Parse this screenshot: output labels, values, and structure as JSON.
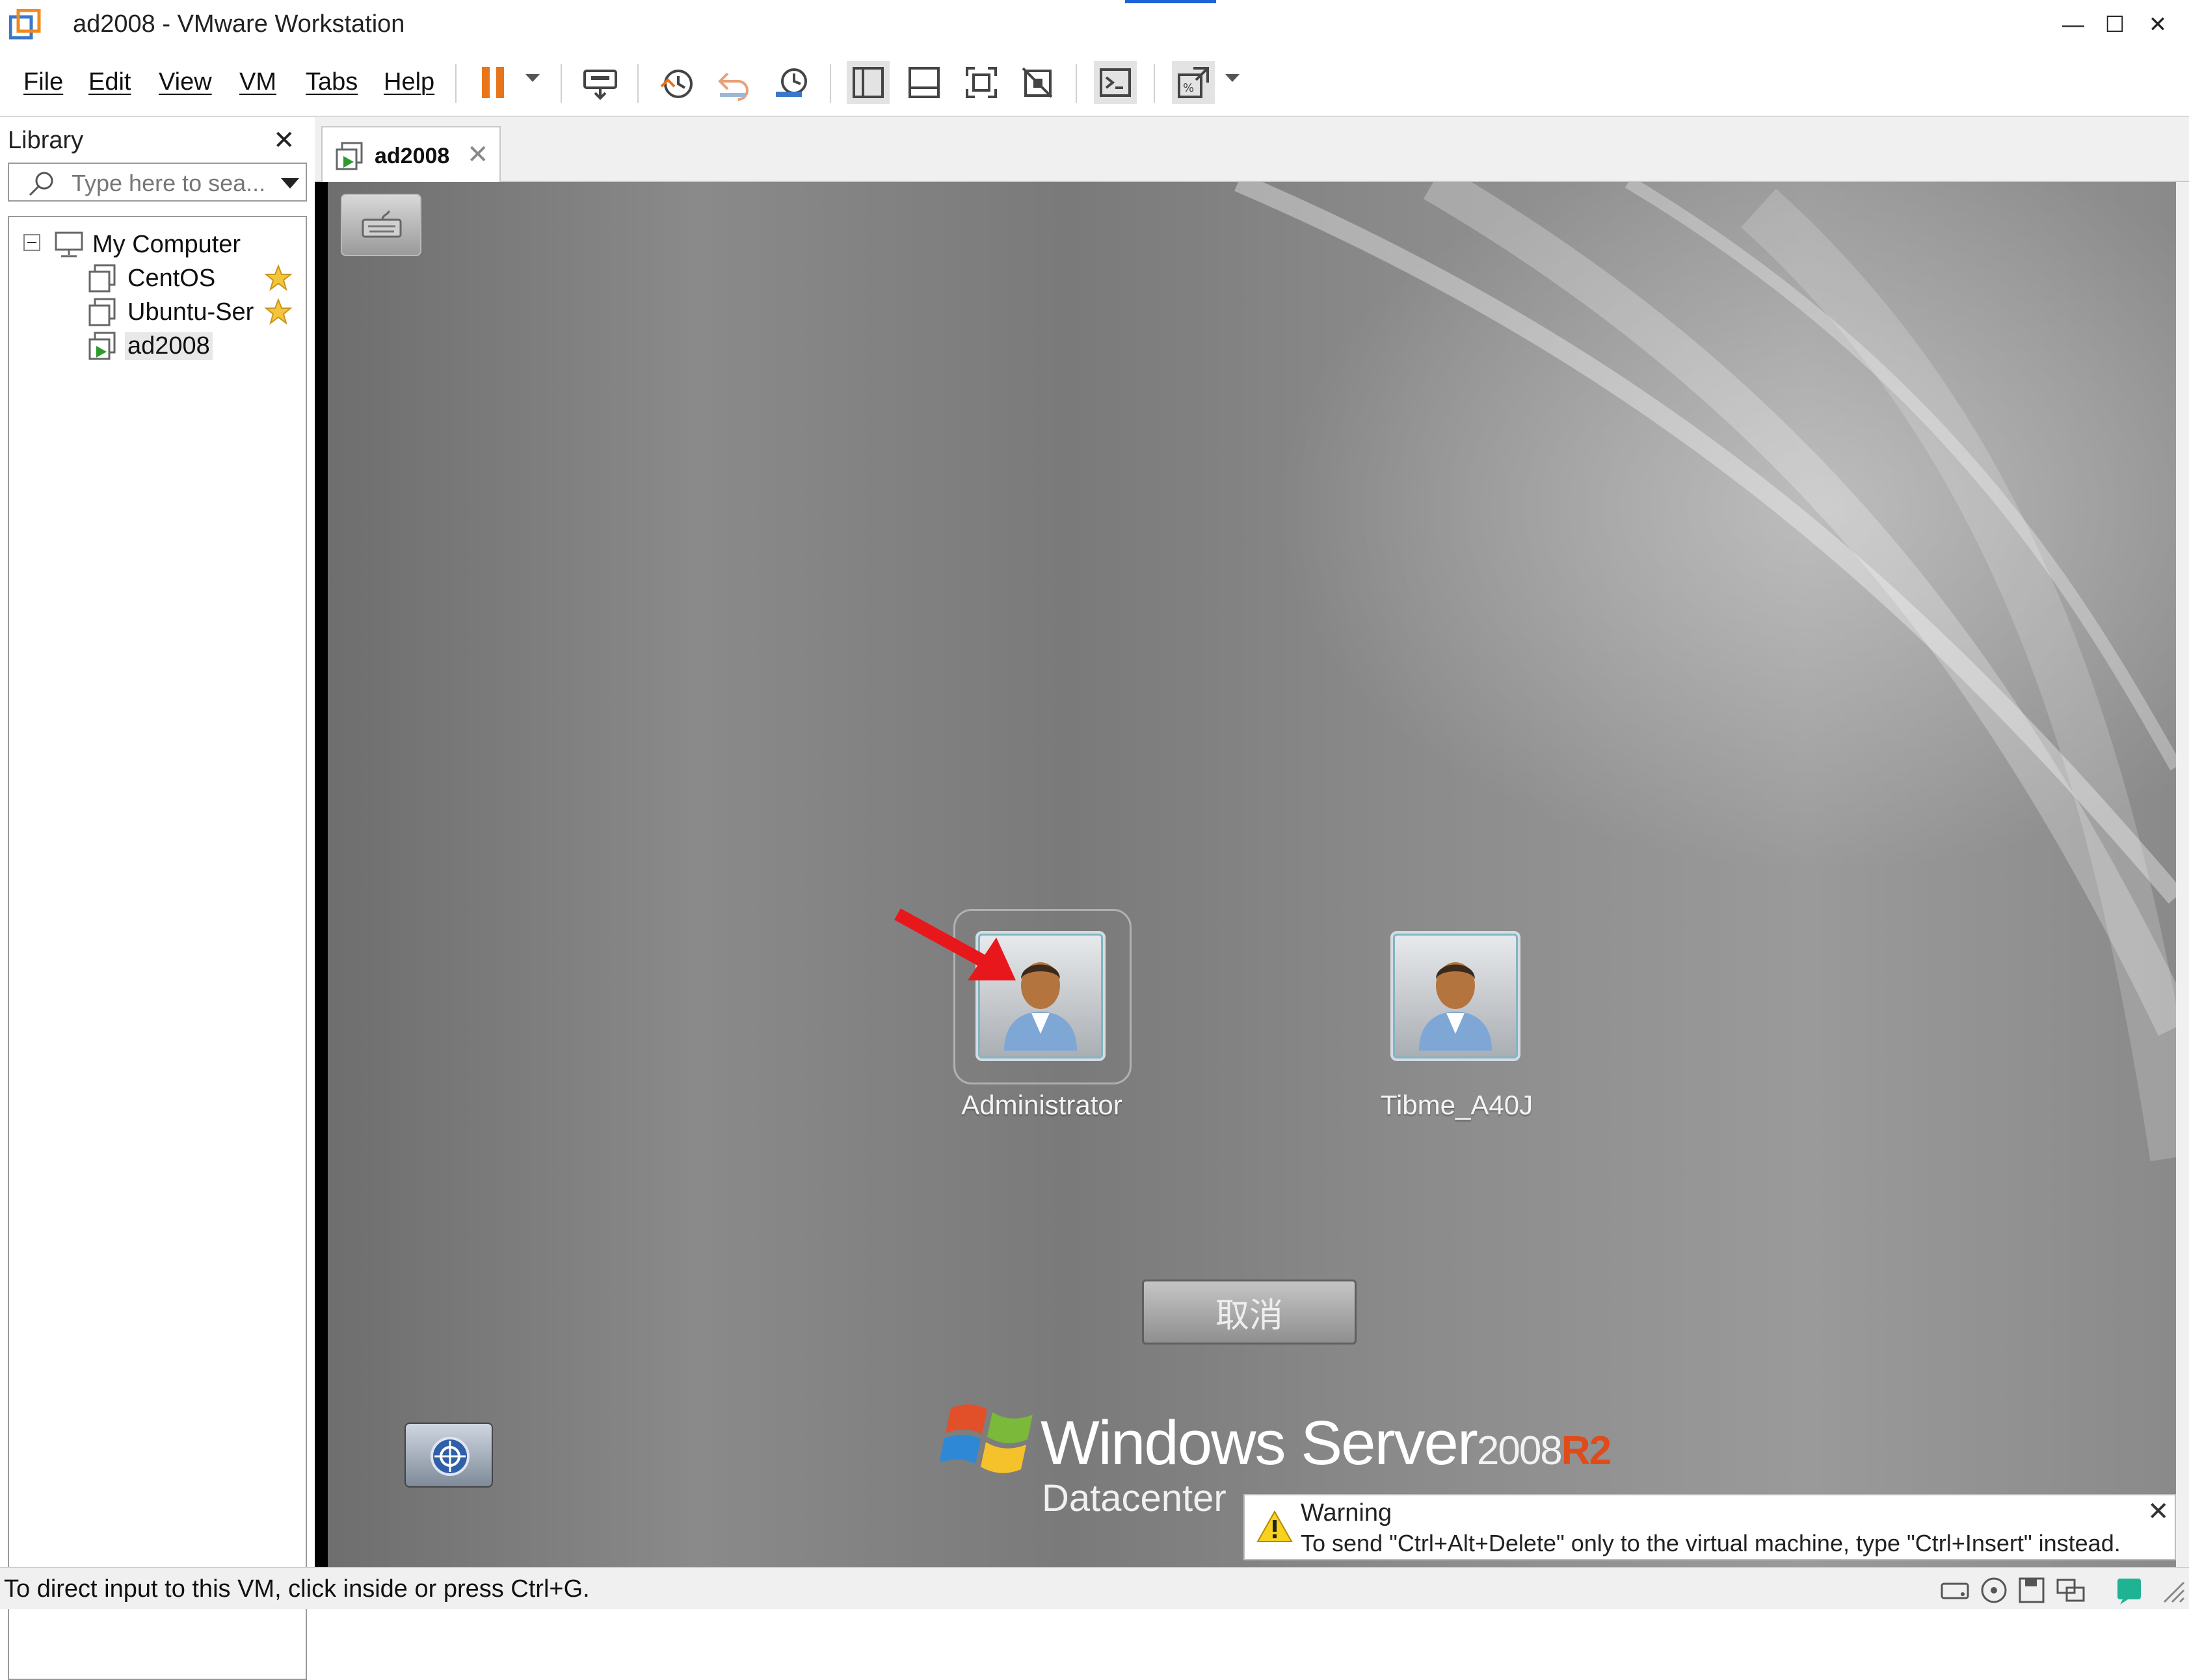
{
  "window": {
    "title": "ad2008 - VMware Workstation",
    "minimize": "—",
    "maximize": "☐",
    "close": "✕"
  },
  "menu": {
    "items": [
      "File",
      "Edit",
      "View",
      "VM",
      "Tabs",
      "Help"
    ]
  },
  "toolbar": {
    "icons": [
      "pause-icon",
      "send-ctrl-alt-del-icon",
      "snapshot-icon",
      "revert-snapshot-icon",
      "snapshot-manager-icon",
      "show-library-icon",
      "thumbnail-bar-icon",
      "full-screen-icon",
      "unity-icon",
      "console-icon",
      "stretch-guest-icon"
    ],
    "accent_color": "#e8751a"
  },
  "library": {
    "title": "Library",
    "close": "✕",
    "search_placeholder": "Type here to sea...",
    "tree": {
      "root": "My Computer",
      "items": [
        {
          "label": "CentOS",
          "favorite": true
        },
        {
          "label": "Ubuntu-Ser",
          "favorite": true
        },
        {
          "label": "ad2008",
          "favorite": false,
          "selected": true,
          "running": true
        }
      ]
    }
  },
  "tabs": [
    {
      "label": "ad2008",
      "close": "✕"
    }
  ],
  "vm": {
    "users": [
      {
        "name": "Administrator"
      },
      {
        "name": "Tibme_A40J"
      }
    ],
    "cancel_label": "取消",
    "brand": {
      "name": "Windows Server",
      "version": "2008",
      "suffix": "R2",
      "edition": "Datacenter",
      "suffix_color": "#e04b1a"
    },
    "warning": {
      "title": "Warning",
      "text": "To send \"Ctrl+Alt+Delete\" only to the virtual machine, type \"Ctrl+Insert\" instead.",
      "close": "✕"
    }
  },
  "statusbar": {
    "text": "To direct input to this VM, click inside or press Ctrl+G."
  }
}
